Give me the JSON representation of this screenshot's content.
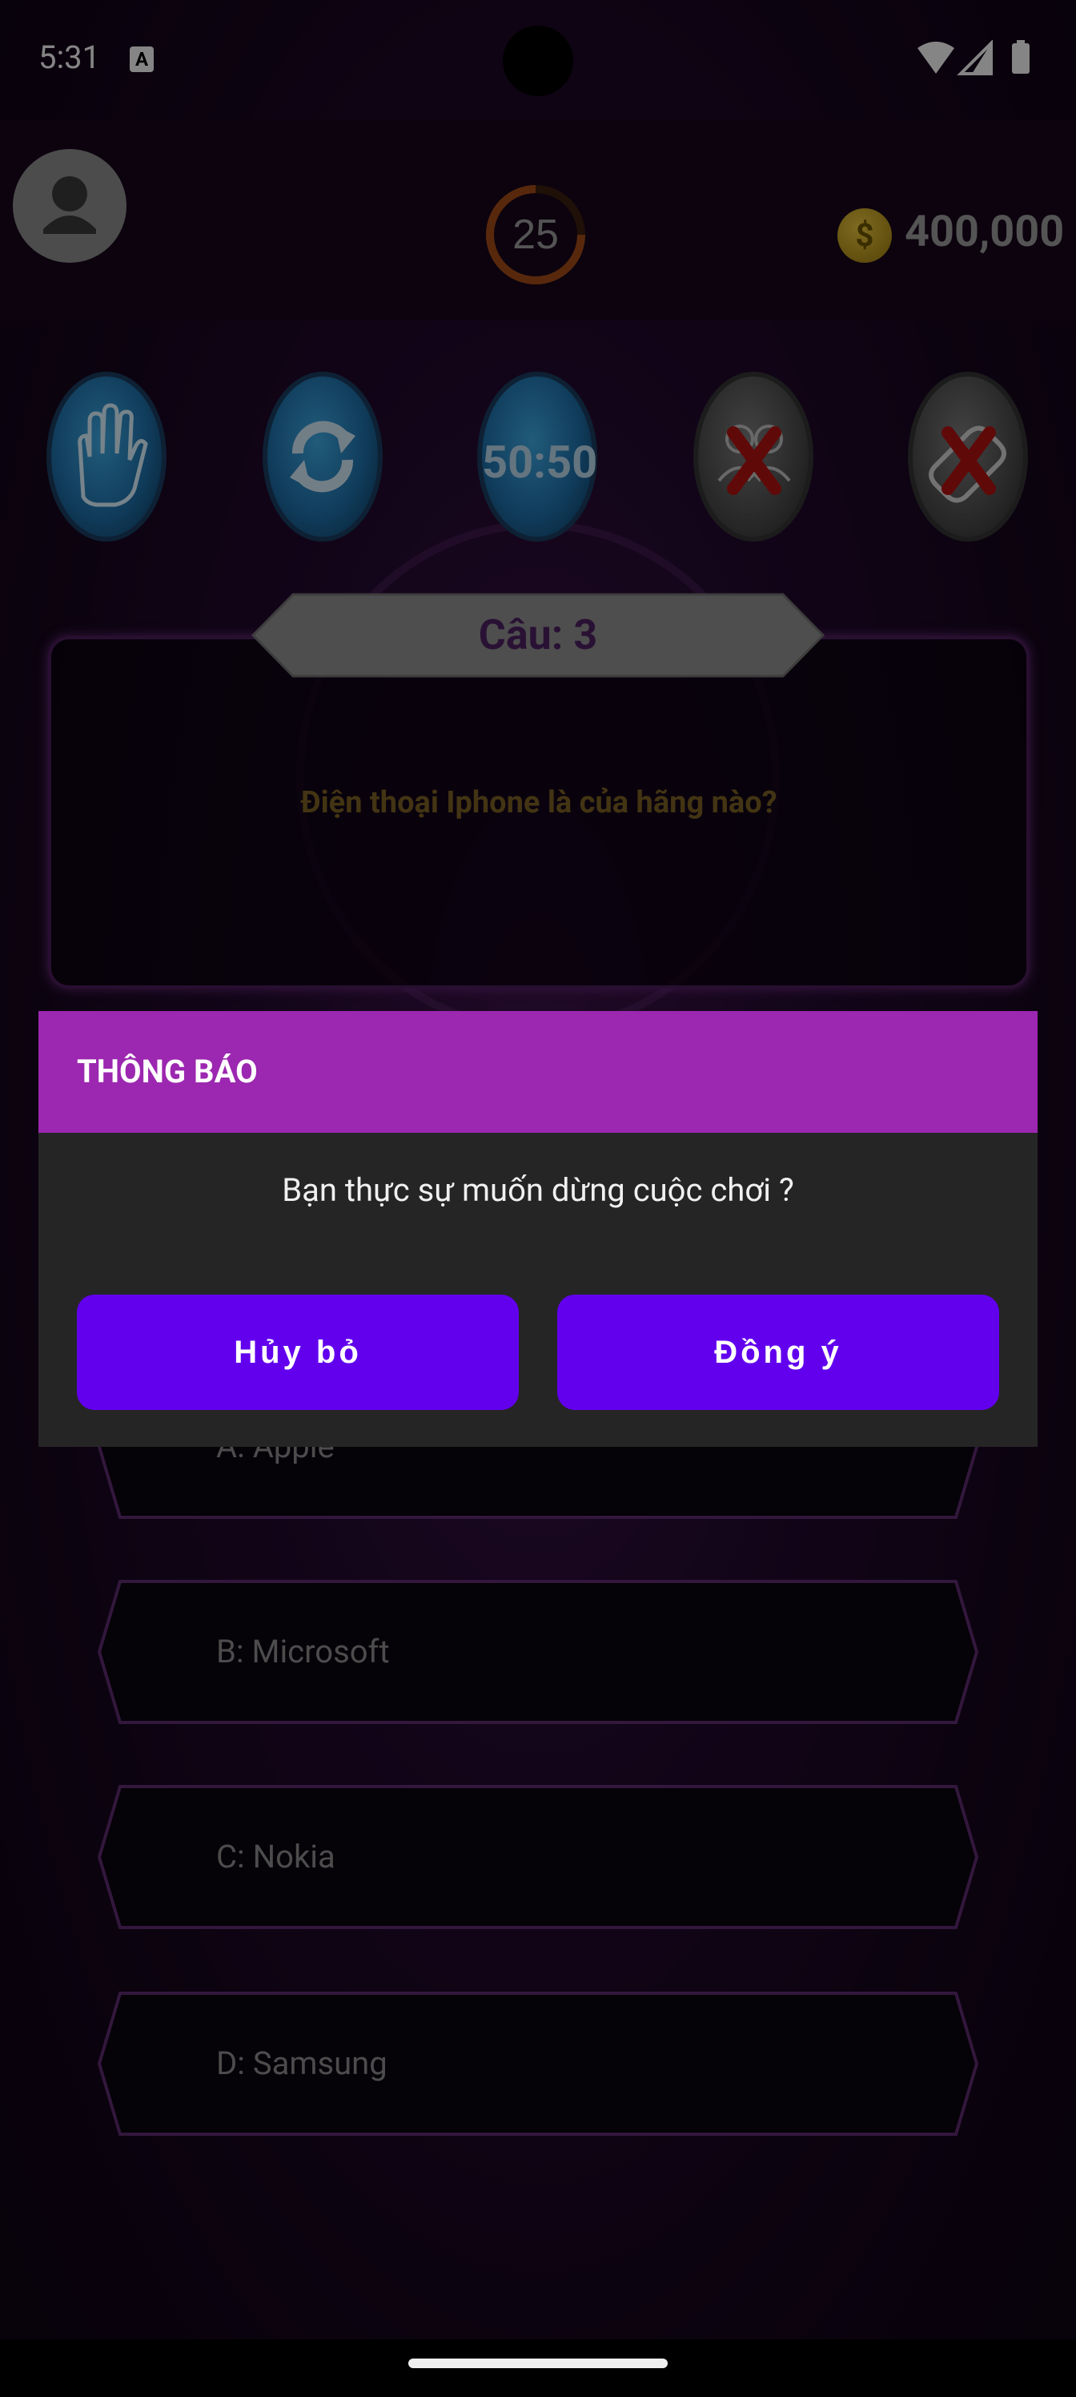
{
  "status_bar": {
    "time": "5:31",
    "a_icon": "A"
  },
  "header": {
    "timer": "25",
    "money": "400,000",
    "coin_symbol": "$"
  },
  "help_buttons": [
    {
      "name": "hand-icon"
    },
    {
      "name": "refresh-icon"
    },
    {
      "label": "50:50"
    },
    {
      "name": "audience-icon-disabled"
    },
    {
      "name": "phone-icon-disabled"
    }
  ],
  "question": {
    "label": "Câu: 3",
    "text": "Điện thoại Iphone là của hãng nào?"
  },
  "answers": [
    {
      "text": "A: Apple"
    },
    {
      "text": "B: Microsoft"
    },
    {
      "text": "C: Nokia"
    },
    {
      "text": "D: Samsung"
    }
  ],
  "dialog": {
    "title": "THÔNG BÁO",
    "message": "Bạn thực sự muốn dừng cuộc chơi ?",
    "cancel_label": "Hủy bỏ",
    "ok_label": "Đồng ý"
  },
  "colors": {
    "dialog_header": "#9c27b0",
    "button": "#6200ee",
    "dialog_body": "#252525"
  }
}
